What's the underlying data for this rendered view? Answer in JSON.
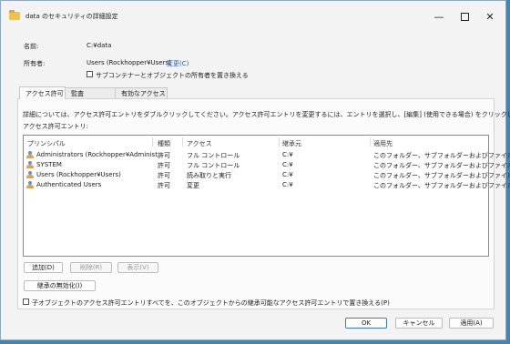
{
  "window": {
    "title": "data のセキュリティの詳細設定",
    "minimize": "—",
    "close": "✕"
  },
  "info": {
    "name_label": "名前:",
    "name_value": "C:¥data",
    "owner_label": "所有者:",
    "owner_value": "Users (Rockhopper¥Users)",
    "change_link": "変更(C)",
    "replace_owner_checkbox": "サブコンテナーとオブジェクトの所有者を置き換える"
  },
  "tabs": [
    "アクセス許可",
    "監査",
    "有効なアクセス"
  ],
  "description": "詳細については、アクセス許可エントリをダブルクリックしてください。アクセス許可エントリを変更するには、エントリを選択し、[編集] (使用できる場合) をクリックします。",
  "entries_label": "アクセス許可エントリ:",
  "table": {
    "headers": [
      "プリンシパル",
      "種類",
      "アクセス",
      "継承元",
      "適用先"
    ],
    "rows": [
      [
        "Administrators (Rockhopper¥Administ...",
        "許可",
        "フル コントロール",
        "C:¥",
        "このフォルダー、サブフォルダーおよびファイル"
      ],
      [
        "SYSTEM",
        "許可",
        "フル コントロール",
        "C:¥",
        "このフォルダー、サブフォルダーおよびファイル"
      ],
      [
        "Users (Rockhopper¥Users)",
        "許可",
        "読み取りと実行",
        "C:¥",
        "このフォルダー、サブフォルダーおよびファイル"
      ],
      [
        "Authenticated Users",
        "許可",
        "変更",
        "C:¥",
        "このフォルダー、サブフォルダーおよびファイル"
      ]
    ]
  },
  "buttons": {
    "add": "追加(D)",
    "remove": "削除(R)",
    "view": "表示(V)",
    "disable_inheritance": "継承の無効化(I)",
    "ok": "OK",
    "cancel": "キャンセル",
    "apply": "適用(A)"
  },
  "replace_child_checkbox": "子オブジェクトのアクセス許可エントリすべてを、このオブジェクトからの継承可能なアクセス許可エントリで置き換える(P)"
}
